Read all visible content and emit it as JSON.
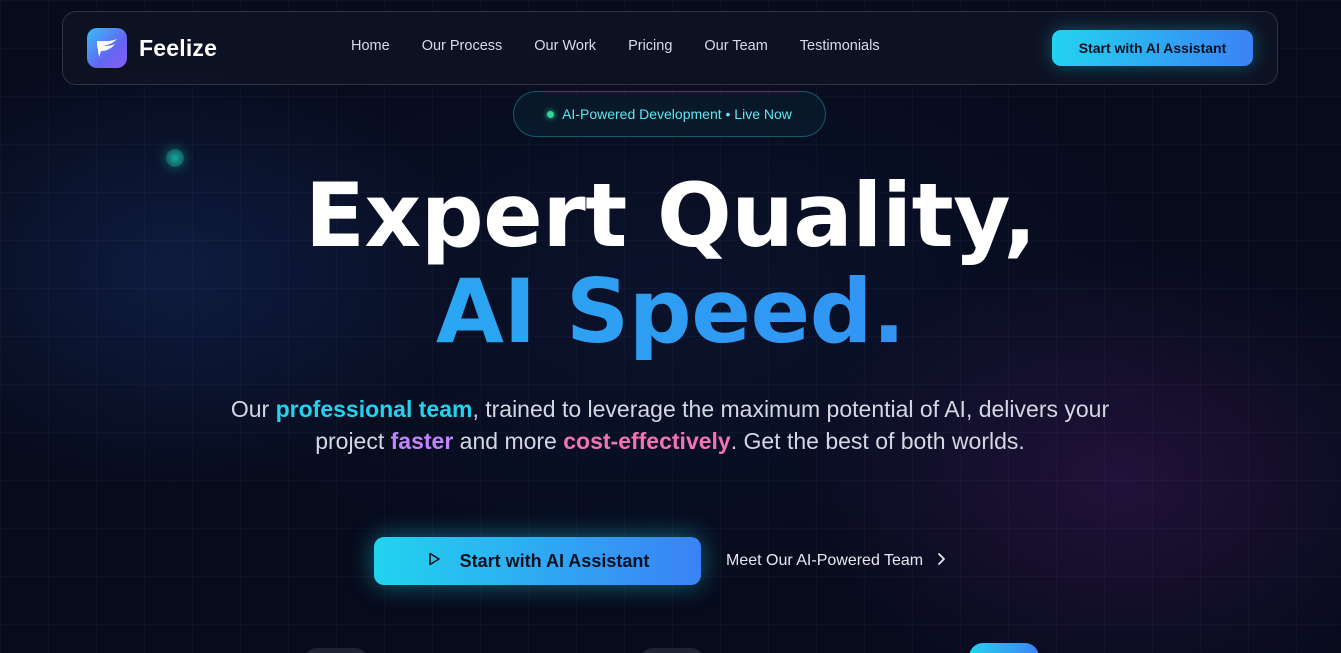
{
  "brand": {
    "name": "Feelize",
    "logo_icon": "bird-icon"
  },
  "nav": {
    "links": [
      "Home",
      "Our Process",
      "Our Work",
      "Pricing",
      "Our Team",
      "Testimonials"
    ],
    "cta_label": "Start with AI Assistant"
  },
  "badge": {
    "text": "AI-Powered Development • Live Now",
    "dot_color": "#34d399"
  },
  "hero": {
    "headline_line1": "Expert Quality,",
    "headline_line2": "AI Speed.",
    "sub": {
      "part1": "Our ",
      "hl1": "professional team",
      "part2": ", trained to leverage the maximum potential of AI, delivers your project ",
      "hl2": "faster",
      "part3": " and more ",
      "hl3": "cost-effectively",
      "part4": ". Get the best of both worlds."
    },
    "primary_cta": {
      "label": "Start with AI Assistant",
      "icon": "play-icon"
    },
    "secondary_cta": {
      "label": "Meet Our AI-Powered Team",
      "icon": "chevron-right-icon"
    }
  },
  "colors": {
    "background": "#070b1c",
    "accent_cyan": "#22d3ee",
    "accent_blue": "#3b82f6",
    "highlight_purple": "#c084fc",
    "highlight_pink": "#f472b6"
  }
}
